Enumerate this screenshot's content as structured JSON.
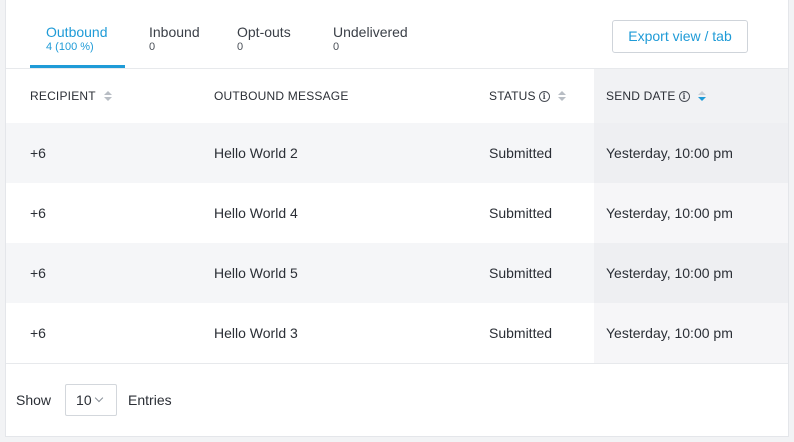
{
  "tabs": [
    {
      "label": "Outbound",
      "count": "4 (100 %)",
      "active": true
    },
    {
      "label": "Inbound",
      "count": "0"
    },
    {
      "label": "Opt-outs",
      "count": "0"
    },
    {
      "label": "Undelivered",
      "count": "0"
    }
  ],
  "export_button": "Export view / tab",
  "columns": {
    "recipient": "RECIPIENT",
    "message": "OUTBOUND MESSAGE",
    "status": "STATUS",
    "send_date": "SEND DATE"
  },
  "sort": {
    "column": "send_date",
    "direction": "descending"
  },
  "rows": [
    {
      "recipient": "+6",
      "message": "Hello World 2",
      "status": "Submitted",
      "send_date": "Yesterday, 10:00 pm"
    },
    {
      "recipient": "+6",
      "message": "Hello World 4",
      "status": "Submitted",
      "send_date": "Yesterday, 10:00 pm"
    },
    {
      "recipient": "+6",
      "message": "Hello World 5",
      "status": "Submitted",
      "send_date": "Yesterday, 10:00 pm"
    },
    {
      "recipient": "+6",
      "message": "Hello World 3",
      "status": "Submitted",
      "send_date": "Yesterday, 10:00 pm"
    }
  ],
  "footer": {
    "show_label": "Show",
    "entries_value": "10",
    "entries_label": "Entries"
  },
  "colors": {
    "accent": "#1f9bd7"
  }
}
